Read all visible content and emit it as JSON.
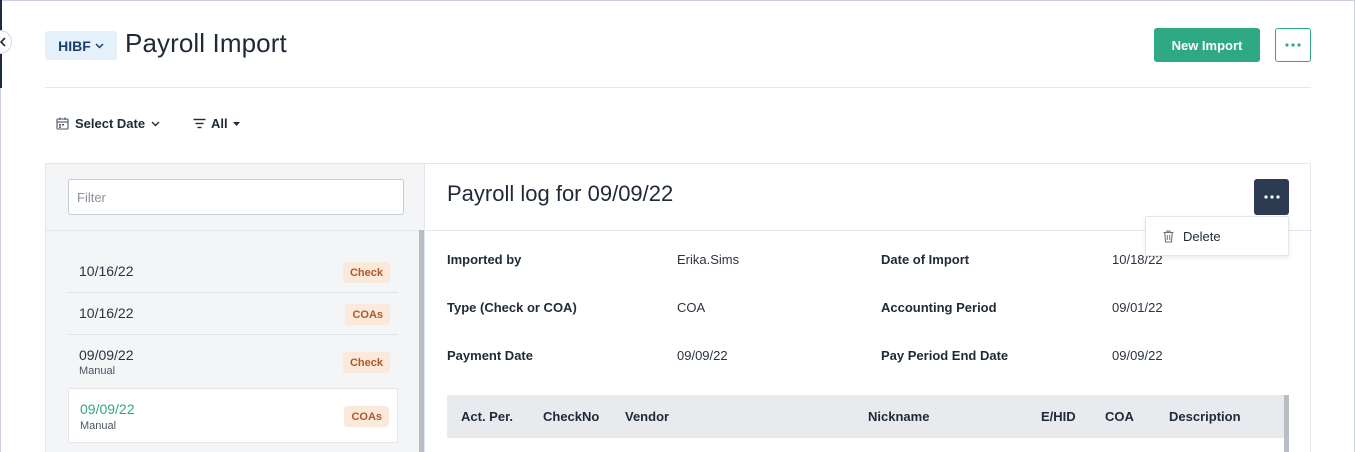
{
  "header": {
    "entity": "HIBF",
    "title": "Payroll Import",
    "new_import_label": "New Import"
  },
  "filters": {
    "date_label": "Select Date",
    "type_label": "All"
  },
  "sidebar": {
    "filter_placeholder": "Filter",
    "items": [
      {
        "date": "10/16/22",
        "sub": "",
        "badge": "Check"
      },
      {
        "date": "10/16/22",
        "sub": "",
        "badge": "COAs"
      },
      {
        "date": "09/09/22",
        "sub": "Manual",
        "badge": "Check"
      },
      {
        "date": "09/09/22",
        "sub": "Manual",
        "badge": "COAs",
        "selected": true
      }
    ]
  },
  "detail": {
    "title": "Payroll log for 09/09/22",
    "menu": {
      "delete_label": "Delete"
    },
    "fields": [
      {
        "label": "Imported by",
        "value": "Erika.Sims"
      },
      {
        "label": "Date of Import",
        "value": "10/18/22"
      },
      {
        "label": "Type (Check or COA)",
        "value": "COA"
      },
      {
        "label": "Accounting Period",
        "value": "09/01/22"
      },
      {
        "label": "Payment Date",
        "value": "09/09/22"
      },
      {
        "label": "Pay Period End Date",
        "value": "09/09/22"
      }
    ],
    "grid_columns": [
      "Act. Per.",
      "CheckNo",
      "Vendor",
      "Nickname",
      "E/HID",
      "COA",
      "Description"
    ]
  },
  "colors": {
    "accent": "#2fa884",
    "dark_button": "#2c3a52",
    "badge_bg": "#fbe9dc",
    "badge_text": "#b4562a",
    "entity_pill_bg": "#e5f1fa"
  }
}
